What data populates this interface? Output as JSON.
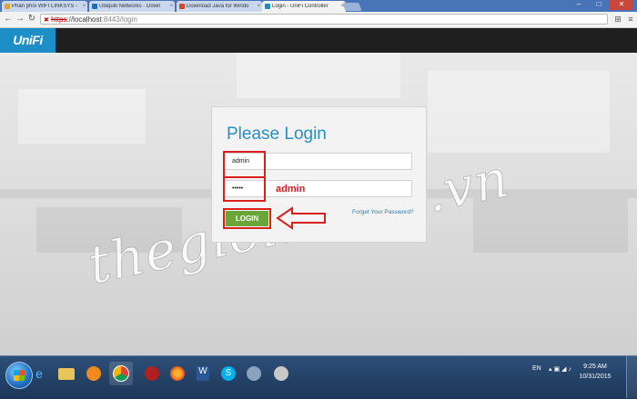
{
  "browser": {
    "tabs": [
      {
        "label": "Phân phối WIFI LINKSYS -",
        "active": false,
        "favicon_color": "#e2a23a"
      },
      {
        "label": "Ubiquiti Networks - Down",
        "active": false,
        "favicon_color": "#1e6fc0"
      },
      {
        "label": "Download Java for Windo",
        "active": false,
        "favicon_color": "#d04a2a"
      },
      {
        "label": "Login - UniFi Controller",
        "active": true,
        "favicon_color": "#1e8fc6"
      }
    ],
    "tab_close_glyph": "×",
    "url": {
      "scheme": "https",
      "separator": "://",
      "host": "localhost",
      "path": ":8443/login"
    },
    "window_buttons": [
      "–",
      "□",
      "✕"
    ],
    "nav": {
      "back": "←",
      "forward": "→",
      "reload": "↻"
    },
    "toolbar_icons": [
      "translate-icon",
      "menu-icon"
    ]
  },
  "app": {
    "logo": "UniFi",
    "accent_color": "#1e8fc6"
  },
  "login": {
    "title": "Please Login",
    "username_value": "admin",
    "password_value": "•••••",
    "annotation_text": "admin",
    "button_label": "LOGIN",
    "forgot_link": "Forget Your Password?"
  },
  "watermark": "thegioimang.vn",
  "taskbar": {
    "language": "EN",
    "time": "9:25 AM",
    "date": "10/31/2015",
    "apps": [
      "ie-icon",
      "folder-icon",
      "media-player-icon",
      "chrome-icon",
      "antivirus-icon",
      "firefox-icon",
      "word-icon",
      "skype-icon",
      "app-icon",
      "disk-icon"
    ]
  }
}
